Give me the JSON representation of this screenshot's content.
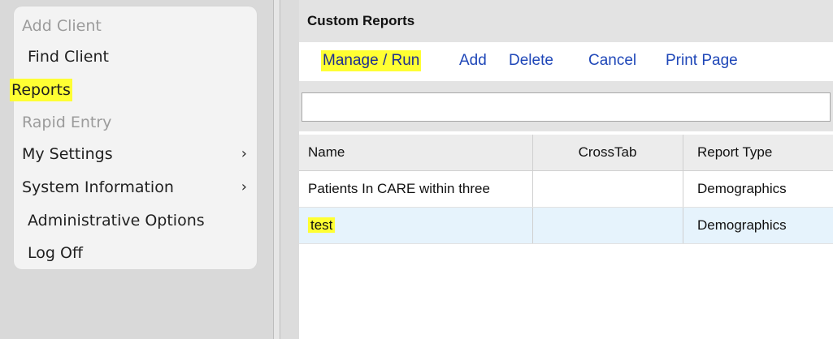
{
  "sidebar": {
    "items": [
      {
        "label": "Add Client"
      },
      {
        "label": "Find Client"
      },
      {
        "label": "Reports"
      },
      {
        "label": "Rapid Entry"
      },
      {
        "label": "My Settings",
        "chevron": "›"
      },
      {
        "label": "System Information",
        "chevron": "›"
      },
      {
        "label": "Administrative Options"
      },
      {
        "label": "Log Off"
      }
    ]
  },
  "main": {
    "title": "Custom Reports",
    "toolbar": {
      "manage_run": "Manage / Run",
      "add": "Add",
      "delete": "Delete",
      "cancel": "Cancel",
      "print_page": "Print Page"
    },
    "search": {
      "value": "",
      "placeholder": ""
    },
    "table": {
      "columns": [
        "Name",
        "CrossTab",
        "Report Type"
      ],
      "rows": [
        {
          "name": "Patients In CARE within three",
          "crosstab": "",
          "type": "Demographics"
        },
        {
          "name": "test",
          "crosstab": "",
          "type": "Demographics"
        }
      ]
    }
  },
  "colors": {
    "highlight": "#ffff33",
    "link": "#1f47b8",
    "selected_row": "#e6f3fc"
  }
}
